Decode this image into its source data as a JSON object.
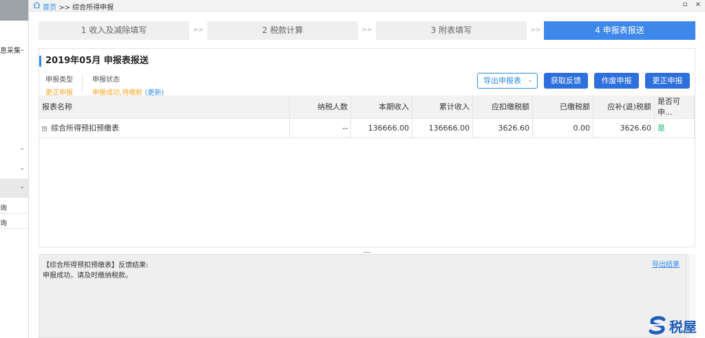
{
  "sidebar": {
    "items": [
      {
        "label": "息采集",
        "has_chevron": true
      },
      {
        "label": "",
        "has_chevron": true
      },
      {
        "label": "",
        "has_chevron": true
      },
      {
        "label": "",
        "has_chevron": true
      }
    ],
    "sub_items": [
      "查询",
      "查询"
    ],
    "bottom_label": "ᴏ"
  },
  "topbar": {
    "home_link": "首页",
    "separator": ">>",
    "current": "综合所得申报",
    "restore_glyph": "▫",
    "close_glyph": "×"
  },
  "steps": [
    {
      "label": "1 收入及减除填写",
      "active": false
    },
    {
      "label": "2 税款计算",
      "active": false
    },
    {
      "label": "3 附表填写",
      "active": false
    },
    {
      "label": "4 申报表报送",
      "active": true
    }
  ],
  "step_separator": ">>",
  "panel": {
    "title": "2019年05月  申报表报送",
    "meta": [
      {
        "label": "申报类型",
        "value": "更正申报"
      },
      {
        "label": "申报状态",
        "value": "申报成功,待缴款",
        "link": "(更新)"
      }
    ],
    "buttons": {
      "export_report": "导出申报表",
      "get_feedback": "获取反馈",
      "void_report": "作废申报",
      "correct_report": "更正申报"
    }
  },
  "table": {
    "headers": [
      "报表名称",
      "纳税人数",
      "本期收入",
      "累计收入",
      "应扣缴税额",
      "已缴税额",
      "应补(退)税额",
      "是否可申..."
    ],
    "rows": [
      {
        "expander": "+",
        "name": "综合所得预扣预缴表",
        "taxpayers": "--",
        "current_income": "136666.00",
        "cumulative_income": "136666.00",
        "tax_payable": "3626.60",
        "tax_paid": "0.00",
        "tax_due": "3626.60",
        "can_declare": "是"
      }
    ]
  },
  "result": {
    "title": "【综合所得预扣预缴表】反馈结果:",
    "message": "申报成功，请及时缴纳税款。",
    "export_link": "导出结果"
  },
  "watermark": {
    "text": "税屋",
    "color": "#1f5fb8"
  },
  "colors": {
    "accent": "#2d8cf0",
    "active_step": "#3e87eb",
    "warning_text": "#f5a623",
    "success_text": "#19be6b"
  }
}
